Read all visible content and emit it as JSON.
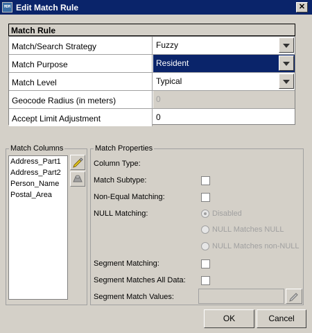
{
  "window": {
    "title": "Edit Match Rule",
    "icon_name": "app-icon",
    "icon_text": "MDM",
    "close_label": "✕"
  },
  "match_rule": {
    "header": "Match Rule",
    "rows": [
      {
        "label": "Match/Search Strategy",
        "value": "Fuzzy"
      },
      {
        "label": "Match Purpose",
        "value": "Resident"
      },
      {
        "label": "Match Level",
        "value": "Typical"
      },
      {
        "label": "Geocode Radius (in meters)",
        "value": "0"
      },
      {
        "label": "Accept Limit Adjustment",
        "value": "0"
      }
    ]
  },
  "match_columns": {
    "label": "Match Columns",
    "items": [
      "Address_Part1",
      "Address_Part2",
      "Person_Name",
      "Postal_Area"
    ],
    "edit_icon": "pencil-icon",
    "delete_icon": "remove-icon"
  },
  "match_properties": {
    "label": "Match Properties",
    "column_type": "Column Type:",
    "match_subtype": "Match Subtype:",
    "non_equal": "Non-Equal Matching:",
    "null_matching": "NULL Matching:",
    "null_options": [
      "Disabled",
      "NULL Matches NULL",
      "NULL Matches non-NULL"
    ],
    "segment_matching": "Segment Matching:",
    "segment_all": "Segment Matches All Data:",
    "segment_values": "Segment Match Values:"
  },
  "buttons": {
    "ok": "OK",
    "cancel": "Cancel"
  },
  "colors": {
    "titlebar": "#0a246a",
    "selection": "#0a246a",
    "face": "#d4d0c8"
  }
}
